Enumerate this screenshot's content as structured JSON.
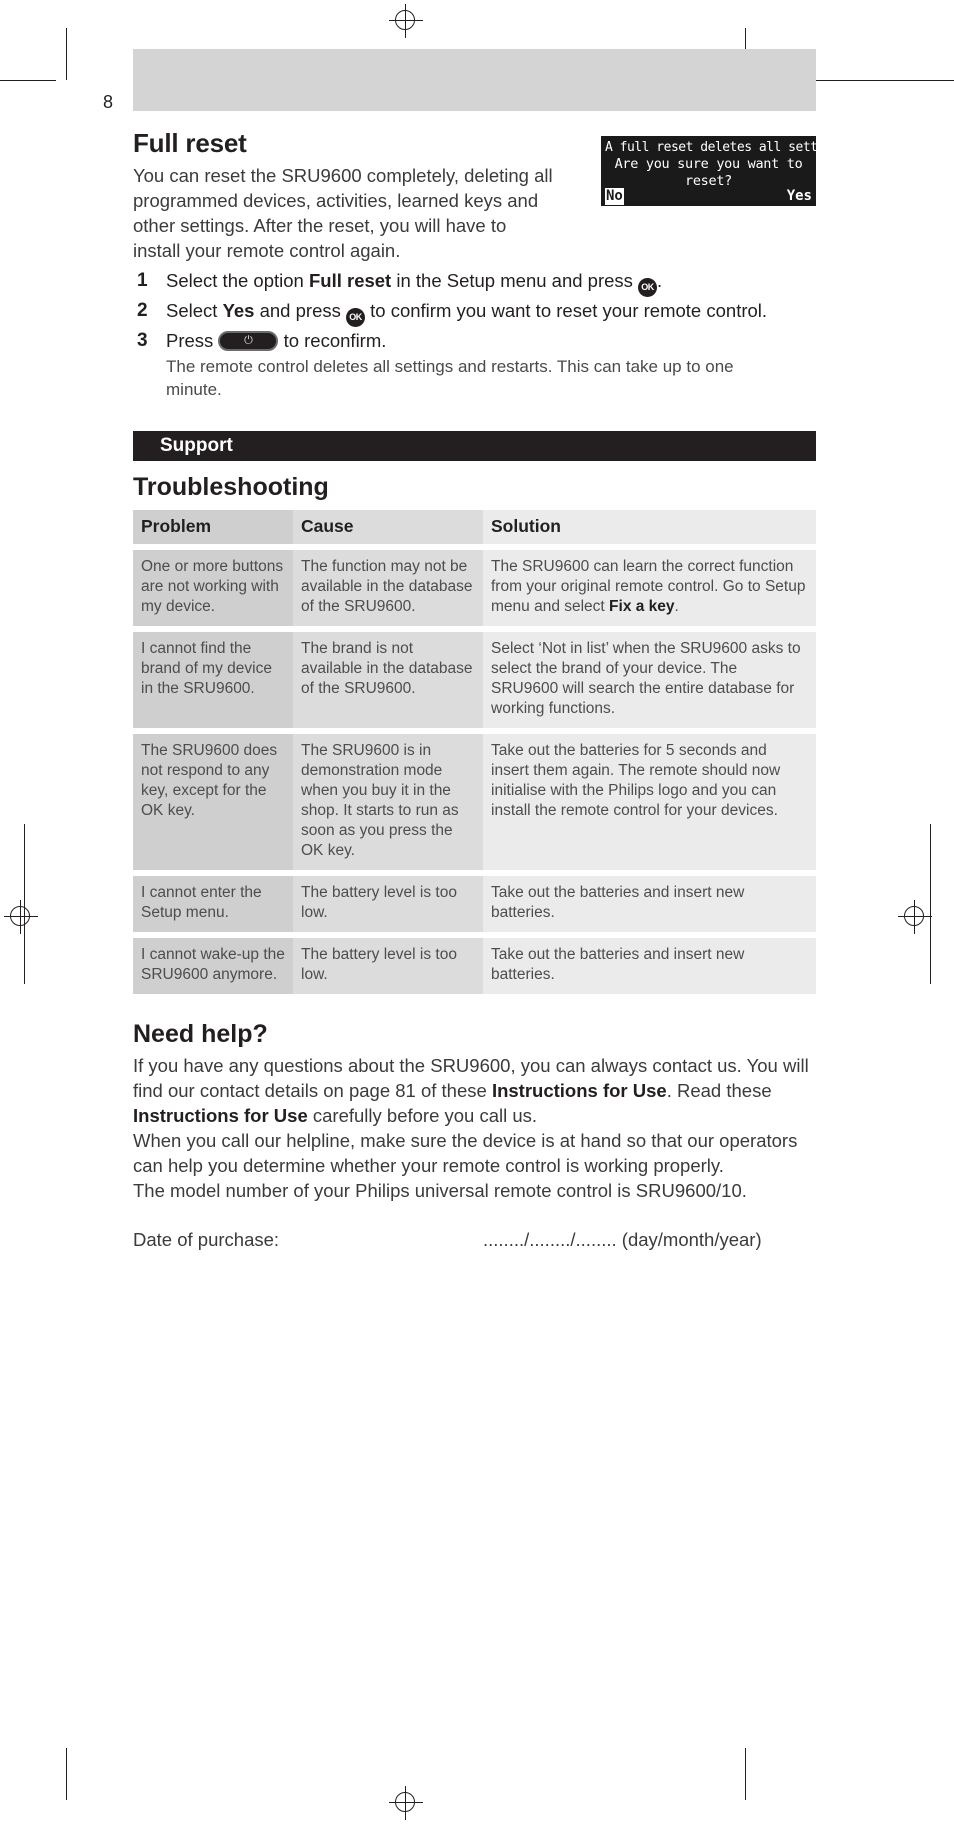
{
  "page": {
    "number": "8"
  },
  "full_reset": {
    "title": "Full reset",
    "intro": "You can reset the SRU9600 completely, deleting all programmed devices, activities, learned keys and other settings. After the reset, you will have to install your remote control again.",
    "steps": [
      {
        "num": "1",
        "before": "Select the option ",
        "bold": "Full reset",
        "after_a": " in the Setup menu and press ",
        "icon": "ok-key-icon",
        "after_b": "."
      },
      {
        "num": "2",
        "before": "Select ",
        "bold": "Yes",
        "after_a": " and press ",
        "icon": "ok-key-icon",
        "after_b": " to confirm you want to reset your remote control."
      },
      {
        "num": "3",
        "before": "Press ",
        "bold": "",
        "after_a": "",
        "icon": "power-key-icon",
        "after_b": " to reconfirm.",
        "note": "The remote control deletes all settings and restarts. This can take up to one minute."
      }
    ]
  },
  "lcd": {
    "line1": "A full reset deletes all settings",
    "line2": "Are you sure you want to",
    "line3": "reset?",
    "no_label": "No",
    "yes_label": "Yes",
    "bg_color": "#1a1a1a",
    "fg_color": "#ffffff"
  },
  "support_banner": {
    "label": "Support",
    "bg_color": "#231f20",
    "text_color": "#ffffff"
  },
  "troubleshooting": {
    "title": "Troubleshooting",
    "headers": [
      "Problem",
      "Cause",
      "Solution"
    ],
    "rows": [
      {
        "problem": "One or more buttons are not working with my device.",
        "cause": "The function may not be available in the database of the SRU9600.",
        "solution_before": "The SRU9600 can learn the correct function from your original remote control. Go to Setup menu and select ",
        "solution_bold": "Fix a key",
        "solution_after": "."
      },
      {
        "problem": "I cannot find the brand of my device in the SRU9600.",
        "cause": "The brand is not available in the database of the SRU9600.",
        "solution_before": "Select ‘Not in list’ when the SRU9600 asks to select the brand of your device. The SRU9600 will search the entire database for working functions.",
        "solution_bold": "",
        "solution_after": ""
      },
      {
        "problem": "The SRU9600 does not respond to any key, except for the OK key.",
        "cause": "The SRU9600 is in demonstration mode when you buy it in the shop. It starts to run as soon as you press the OK key.",
        "solution_before": "Take out the batteries for 5 seconds and insert them again. The remote should now initialise with the Philips logo and you can install the remote control for your devices.",
        "solution_bold": "",
        "solution_after": ""
      },
      {
        "problem": "I cannot enter the Setup menu.",
        "cause": "The battery level is too low.",
        "solution_before": "Take out the batteries and insert new batteries.",
        "solution_bold": "",
        "solution_after": ""
      },
      {
        "problem": "I cannot wake-up the SRU9600 anymore.",
        "cause": "The battery level is too low.",
        "solution_before": "Take out the batteries and insert new batteries.",
        "solution_bold": "",
        "solution_after": ""
      }
    ]
  },
  "need_help": {
    "title": "Need help?",
    "para1_a": "If you have any questions about the SRU9600, you can always contact us. You will find our contact details on page 81 of these ",
    "para1_bold1": "Instructions for Use",
    "para1_b": ". Read these ",
    "para1_bold2": "Instructions for Use",
    "para1_c": " carefully before you call us.",
    "para2": "When you call our helpline, make sure the device is at hand so that our operators can help you determine whether your remote control is working properly.",
    "para3": "The model number of your Philips universal remote control is SRU9600/10.",
    "purchase_label": "Date of purchase:",
    "purchase_value": "......../......../........ (day/month/year)"
  }
}
